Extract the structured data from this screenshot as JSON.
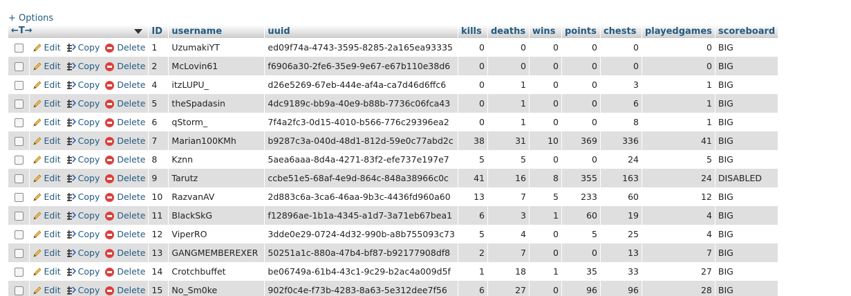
{
  "options_link": "+ Options",
  "header": {
    "arrows": "←T→",
    "columns": [
      "ID",
      "username",
      "uuid",
      "kills",
      "deaths",
      "wins",
      "points",
      "chests",
      "playedgames",
      "scoreboard"
    ]
  },
  "actions": {
    "edit": "Edit",
    "copy": "Copy",
    "delete": "Delete"
  },
  "rows": [
    {
      "id": "1",
      "username": "UzumakiYT",
      "uuid": "ed09f74a-4743-3595-8285-2a165ea93335",
      "kills": "0",
      "deaths": "0",
      "wins": "0",
      "points": "0",
      "chests": "0",
      "playedgames": "0",
      "scoreboard": "BIG"
    },
    {
      "id": "2",
      "username": "McLovin61",
      "uuid": "f6906a30-2fe6-35e9-9e67-e67b110e38d6",
      "kills": "0",
      "deaths": "0",
      "wins": "0",
      "points": "0",
      "chests": "0",
      "playedgames": "0",
      "scoreboard": "BIG"
    },
    {
      "id": "4",
      "username": "itzLUPU_",
      "uuid": "d26e5269-67eb-444e-af4a-ca7d46d6ffc6",
      "kills": "0",
      "deaths": "1",
      "wins": "0",
      "points": "0",
      "chests": "3",
      "playedgames": "1",
      "scoreboard": "BIG"
    },
    {
      "id": "5",
      "username": "theSpadasin",
      "uuid": "4dc9189c-bb9a-40e9-b88b-7736c06fca43",
      "kills": "0",
      "deaths": "1",
      "wins": "0",
      "points": "0",
      "chests": "6",
      "playedgames": "1",
      "scoreboard": "BIG"
    },
    {
      "id": "6",
      "username": "qStorm_",
      "uuid": "7f4a2fc3-0d15-4010-b566-776c29396ea2",
      "kills": "0",
      "deaths": "1",
      "wins": "0",
      "points": "0",
      "chests": "8",
      "playedgames": "1",
      "scoreboard": "BIG"
    },
    {
      "id": "7",
      "username": "Marian100KMh",
      "uuid": "b9287c3a-040d-48d1-812d-59e0c77abd2c",
      "kills": "38",
      "deaths": "31",
      "wins": "10",
      "points": "369",
      "chests": "336",
      "playedgames": "41",
      "scoreboard": "BIG"
    },
    {
      "id": "8",
      "username": "Kznn",
      "uuid": "5aea6aaa-8d4a-4271-83f2-efe737e197e7",
      "kills": "5",
      "deaths": "5",
      "wins": "0",
      "points": "0",
      "chests": "24",
      "playedgames": "5",
      "scoreboard": "BIG"
    },
    {
      "id": "9",
      "username": "Tarutz",
      "uuid": "ccbe51e5-68af-4e9d-864c-848a38966c0c",
      "kills": "41",
      "deaths": "16",
      "wins": "8",
      "points": "355",
      "chests": "163",
      "playedgames": "24",
      "scoreboard": "DISABLED"
    },
    {
      "id": "10",
      "username": "RazvanAV",
      "uuid": "2d883c6a-3ca6-46aa-9b3c-4436fd960a60",
      "kills": "13",
      "deaths": "7",
      "wins": "5",
      "points": "233",
      "chests": "60",
      "playedgames": "12",
      "scoreboard": "BIG"
    },
    {
      "id": "11",
      "username": "BlackSkG",
      "uuid": "f12896ae-1b1a-4345-a1d7-3a71eb67bea1",
      "kills": "6",
      "deaths": "3",
      "wins": "1",
      "points": "60",
      "chests": "19",
      "playedgames": "4",
      "scoreboard": "BIG"
    },
    {
      "id": "12",
      "username": "ViperRO",
      "uuid": "3dde0e29-0724-4d32-990b-a8b755093c73",
      "kills": "5",
      "deaths": "4",
      "wins": "0",
      "points": "5",
      "chests": "25",
      "playedgames": "4",
      "scoreboard": "BIG"
    },
    {
      "id": "13",
      "username": "GANGMEMBEREXER",
      "uuid": "50251a1c-880a-47b4-bf87-b92177908df8",
      "kills": "2",
      "deaths": "7",
      "wins": "0",
      "points": "0",
      "chests": "13",
      "playedgames": "7",
      "scoreboard": "BIG"
    },
    {
      "id": "14",
      "username": "Crotchbuffet",
      "uuid": "be06749a-61b4-43c1-9c29-b2ac4a009d5f",
      "kills": "1",
      "deaths": "18",
      "wins": "1",
      "points": "35",
      "chests": "33",
      "playedgames": "27",
      "scoreboard": "BIG"
    },
    {
      "id": "15",
      "username": "No_Sm0ke",
      "uuid": "902f0c4e-f73b-4283-8a63-5e312dee7f56",
      "kills": "6",
      "deaths": "27",
      "wins": "0",
      "points": "96",
      "chests": "96",
      "playedgames": "28",
      "scoreboard": "BIG"
    }
  ]
}
